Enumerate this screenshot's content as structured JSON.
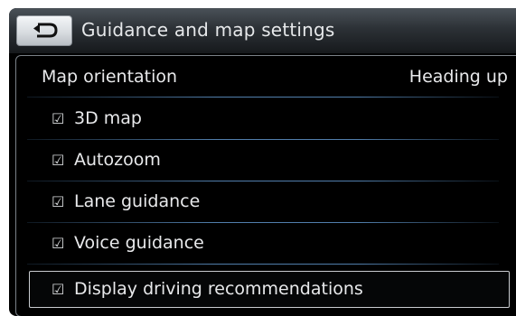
{
  "header": {
    "back_icon": "back-arrow-icon",
    "title": "Guidance and map settings"
  },
  "settings": {
    "map_orientation": {
      "label": "Map orientation",
      "value": "Heading up"
    },
    "checkbox_items": [
      {
        "label": "3D map",
        "checked": true,
        "check_glyph": "☑"
      },
      {
        "label": "Autozoom",
        "checked": true,
        "check_glyph": "☑"
      },
      {
        "label": "Lane guidance",
        "checked": true,
        "check_glyph": "☑"
      },
      {
        "label": "Voice guidance",
        "checked": true,
        "check_glyph": "☑"
      },
      {
        "label": "Display driving recommendations",
        "checked": true,
        "check_glyph": "☑"
      }
    ]
  },
  "colors": {
    "background": "#000000",
    "text": "#e8e9eb",
    "divider": "#5a8cbe",
    "selection_border": "#c9ccd0"
  }
}
